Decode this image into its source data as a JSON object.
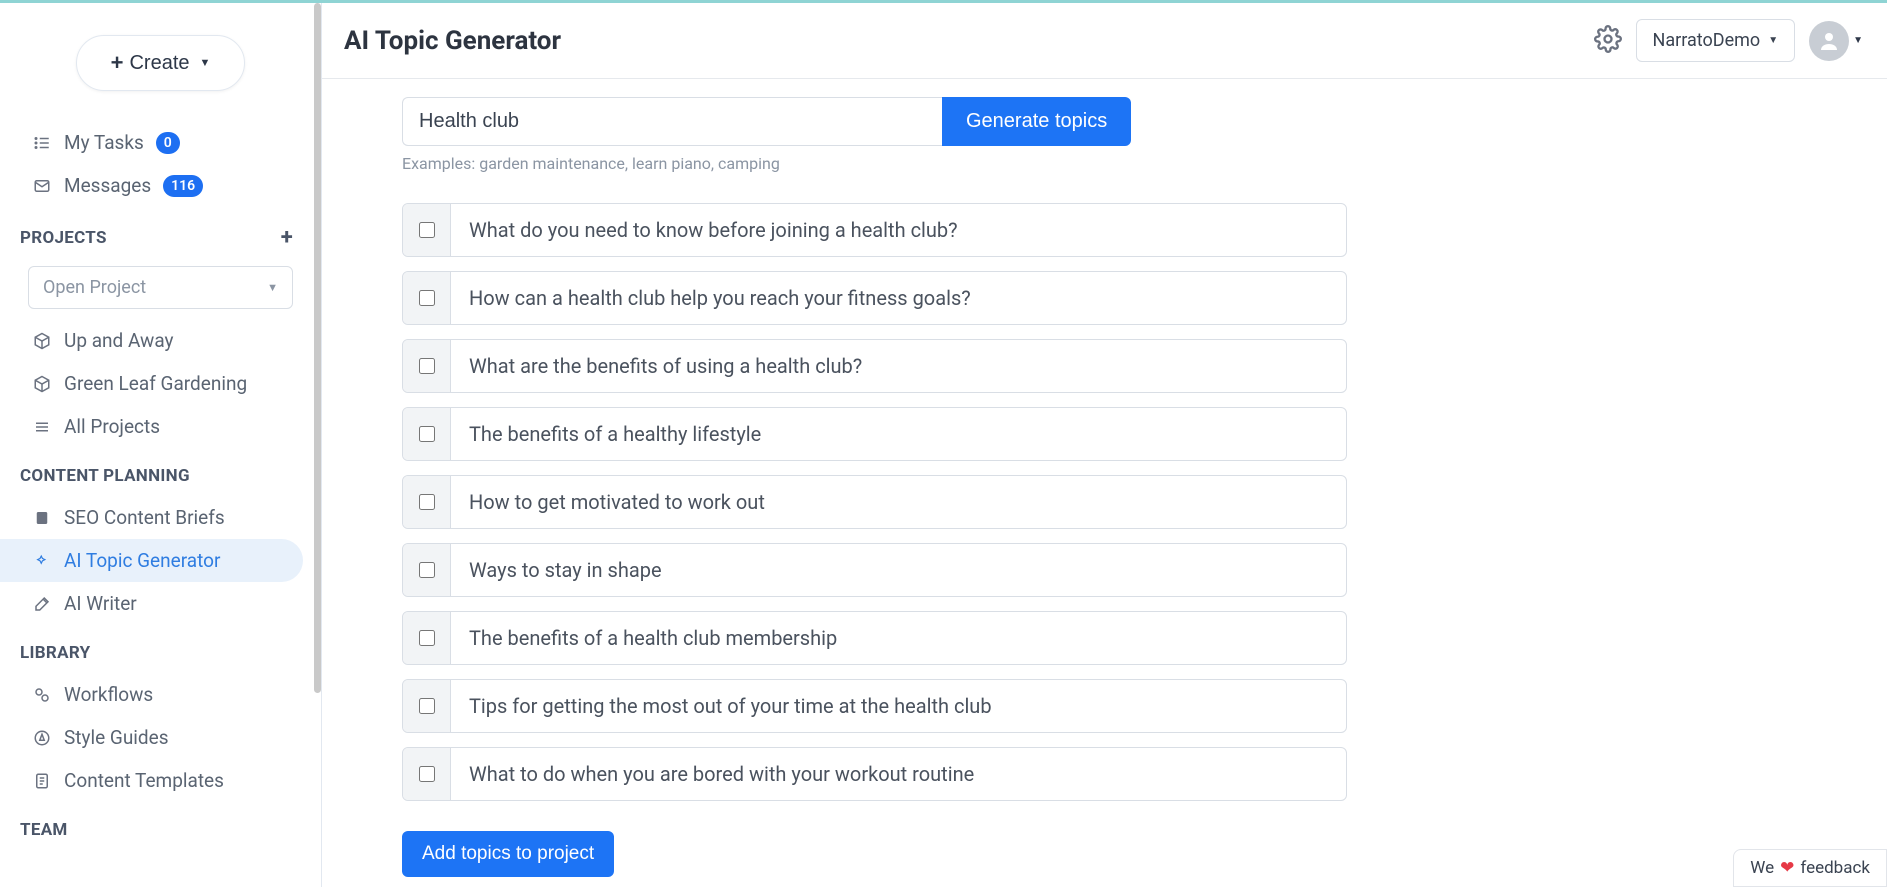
{
  "header": {
    "title": "AI Topic Generator",
    "workspace": "NarratoDemo"
  },
  "create_label": "Create",
  "sidebar": {
    "tasks": {
      "label": "My Tasks",
      "count": "0"
    },
    "messages": {
      "label": "Messages",
      "count": "116"
    },
    "projects_header": "PROJECTS",
    "open_project_placeholder": "Open Project",
    "projects": [
      {
        "label": "Up and Away"
      },
      {
        "label": "Green Leaf Gardening"
      },
      {
        "label": "All Projects"
      }
    ],
    "content_planning_header": "CONTENT PLANNING",
    "planning": [
      {
        "label": "SEO Content Briefs"
      },
      {
        "label": "AI Topic Generator"
      },
      {
        "label": "AI Writer"
      }
    ],
    "library_header": "LIBRARY",
    "library": [
      {
        "label": "Workflows"
      },
      {
        "label": "Style Guides"
      },
      {
        "label": "Content Templates"
      }
    ],
    "team_header": "TEAM"
  },
  "generator": {
    "input_value": "Health club",
    "button_label": "Generate topics",
    "examples_text": "Examples: garden maintenance, learn piano, camping",
    "topics": [
      "What do you need to know before joining a health club?",
      "How can a health club help you reach your fitness goals?",
      "What are the benefits of using a health club?",
      "The benefits of a healthy lifestyle",
      "How to get motivated to work out",
      "Ways to stay in shape",
      "The benefits of a health club membership",
      "Tips for getting the most out of your time at the health club",
      "What to do when you are bored with your workout routine"
    ],
    "add_button_label": "Add topics to project"
  },
  "feedback": {
    "prefix": "We",
    "suffix": "feedback"
  }
}
